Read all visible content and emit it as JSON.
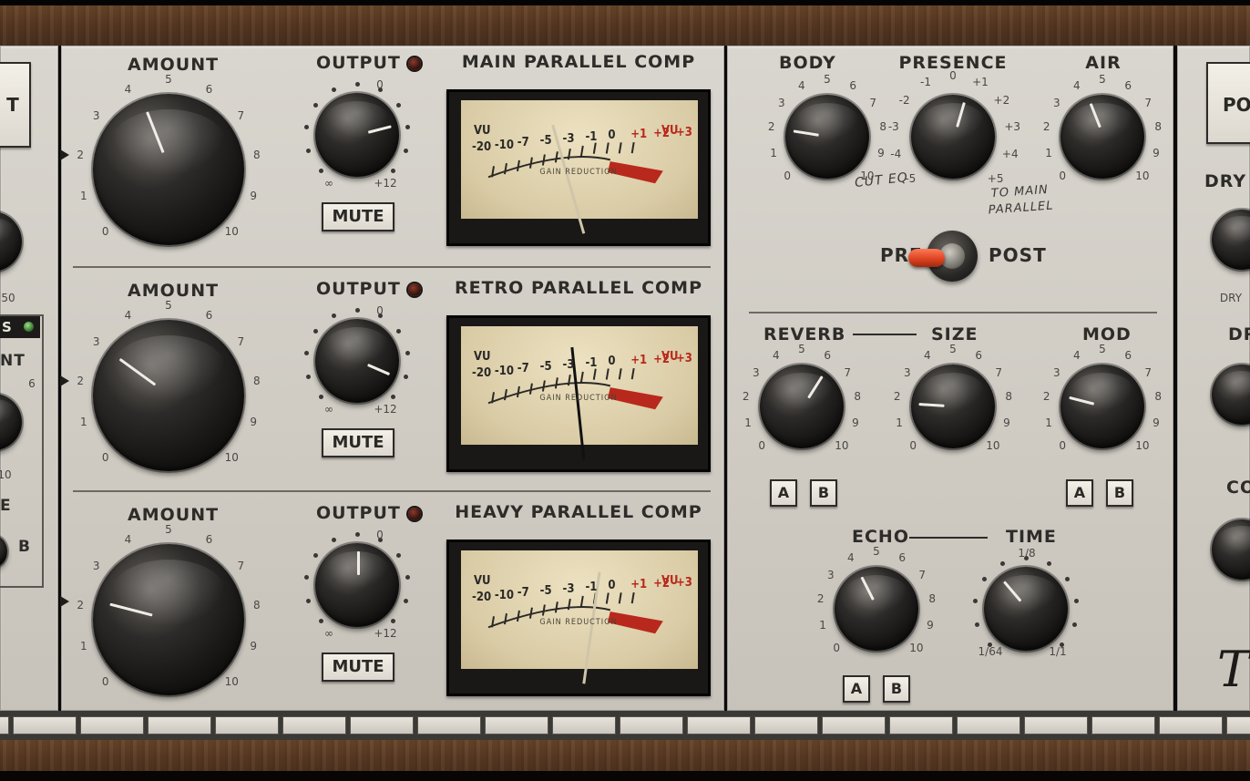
{
  "plugin": {
    "left_strip": {
      "button_label": "T",
      "badge_label": "S",
      "label_nt": "NT",
      "label_e": "E",
      "num_50": "50",
      "num_b": "B",
      "num_6": "6",
      "num_10": "10"
    },
    "channels": [
      {
        "amount_label": "AMOUNT",
        "output_label": "OUTPUT",
        "mute_label": "MUTE",
        "title": "MAIN PARALLEL COMP",
        "amount_ticks": [
          "0",
          "1",
          "2",
          "3",
          "4",
          "5",
          "6",
          "7",
          "8",
          "9",
          "10"
        ],
        "output_ticks": {
          "top": "0",
          "left": "∞",
          "right": "+12"
        }
      },
      {
        "amount_label": "AMOUNT",
        "output_label": "OUTPUT",
        "mute_label": "MUTE",
        "title": "RETRO PARALLEL COMP",
        "amount_ticks": [
          "0",
          "1",
          "2",
          "3",
          "4",
          "5",
          "6",
          "7",
          "8",
          "9",
          "10"
        ],
        "output_ticks": {
          "top": "0",
          "left": "∞",
          "right": "+12"
        }
      },
      {
        "amount_label": "AMOUNT",
        "output_label": "OUTPUT",
        "mute_label": "MUTE",
        "title": "HEAVY PARALLEL COMP",
        "amount_ticks": [
          "0",
          "1",
          "2",
          "3",
          "4",
          "5",
          "6",
          "7",
          "8",
          "9",
          "10"
        ],
        "output_ticks": {
          "top": "0",
          "left": "∞",
          "right": "+12"
        }
      }
    ],
    "vu": {
      "vu_label": "VU",
      "scale": [
        "-20",
        "-10",
        "-7",
        "-5",
        "-3",
        "-1",
        "0",
        "+1",
        "+2",
        "+3"
      ],
      "caption": "GAIN REDUCTION"
    },
    "eq": {
      "body_label": "BODY",
      "presence_label": "PRESENCE",
      "air_label": "AIR",
      "presence_ticks": [
        "-5",
        "-4",
        "-3",
        "-2",
        "-1",
        "0",
        "+1",
        "+2",
        "+3",
        "+4",
        "+5"
      ],
      "note_cut": "CUT EQ",
      "note_main": "TO MAIN PARALLEL",
      "switch_pre": "PRE",
      "switch_post": "POST"
    },
    "fx": {
      "reverb_label": "REVERB",
      "size_label": "SIZE",
      "mod_label": "MOD",
      "echo_label": "ECHO",
      "time_label": "TIME",
      "a_label": "A",
      "b_label": "B",
      "time_ticks": {
        "top": "1/8",
        "left": "1/64",
        "right": "1/1"
      }
    },
    "right_strip": {
      "button_label": "PO",
      "dry_label": "DRY",
      "dry2_label": "DR",
      "co_label": "CO",
      "dry_small": "DRY"
    },
    "knob_values": {
      "main_amount": 0.42,
      "main_output": 0.78,
      "retro_amount": 0.3,
      "retro_output": 0.92,
      "heavy_amount": 0.22,
      "heavy_output": 0.5,
      "body": 0.2,
      "presence": 0.56,
      "air": 0.42,
      "reverb": 0.62,
      "size": 0.18,
      "mod": 0.22,
      "echo": 0.4,
      "time": 0.35
    },
    "switch_state": "PRE"
  }
}
